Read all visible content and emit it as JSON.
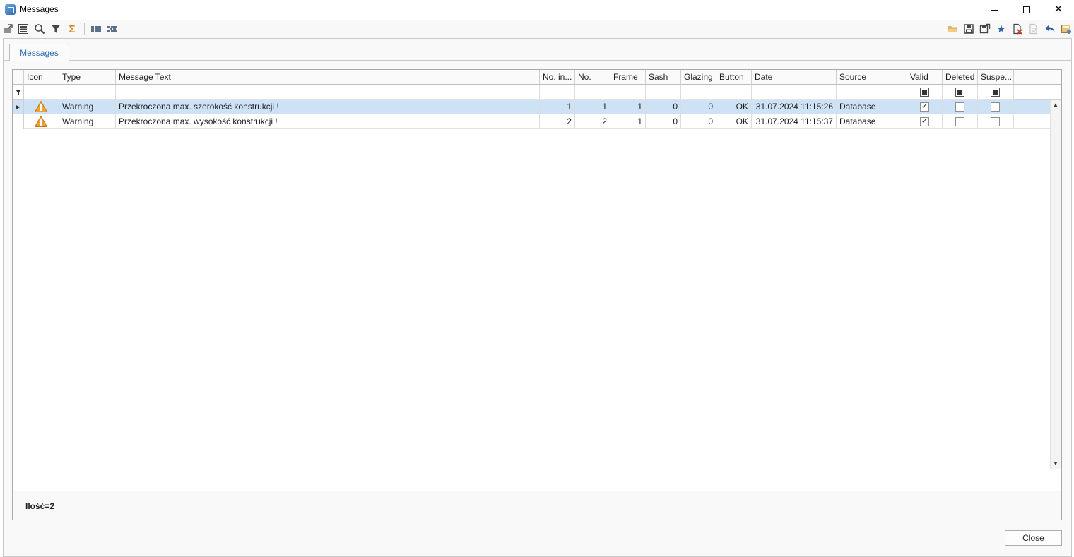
{
  "window": {
    "title": "Messages"
  },
  "tabs": [
    {
      "label": "Messages"
    }
  ],
  "grid": {
    "columns": [
      "Icon",
      "Type",
      "Message Text",
      "No. in...",
      "No.",
      "Frame",
      "Sash",
      "Glazing",
      "Button",
      "Date",
      "Source",
      "Valid",
      "Deleted",
      "Suspe..."
    ],
    "rows": [
      {
        "icon": "warning-icon",
        "type": "Warning",
        "message": "Przekroczona max. szerokość konstrukcji !",
        "no_in": "1",
        "no": "1",
        "frame": "1",
        "sash": "0",
        "glazing": "0",
        "button": "OK",
        "date": "31.07.2024 11:15:26",
        "source": "Database",
        "valid": true,
        "deleted": false,
        "suspended": false,
        "selected": true
      },
      {
        "icon": "warning-icon",
        "type": "Warning",
        "message": "Przekroczona max. wysokość konstrukcji !",
        "no_in": "2",
        "no": "2",
        "frame": "1",
        "sash": "0",
        "glazing": "0",
        "button": "OK",
        "date": "31.07.2024 11:15:37",
        "source": "Database",
        "valid": true,
        "deleted": false,
        "suspended": false,
        "selected": false
      }
    ]
  },
  "footer": {
    "count": "Ilość=2"
  },
  "buttons": {
    "close": "Close"
  },
  "colors": {
    "selected_row": "#cde3f5",
    "tab_text": "#2a6db5",
    "warning": "#f0a030"
  }
}
